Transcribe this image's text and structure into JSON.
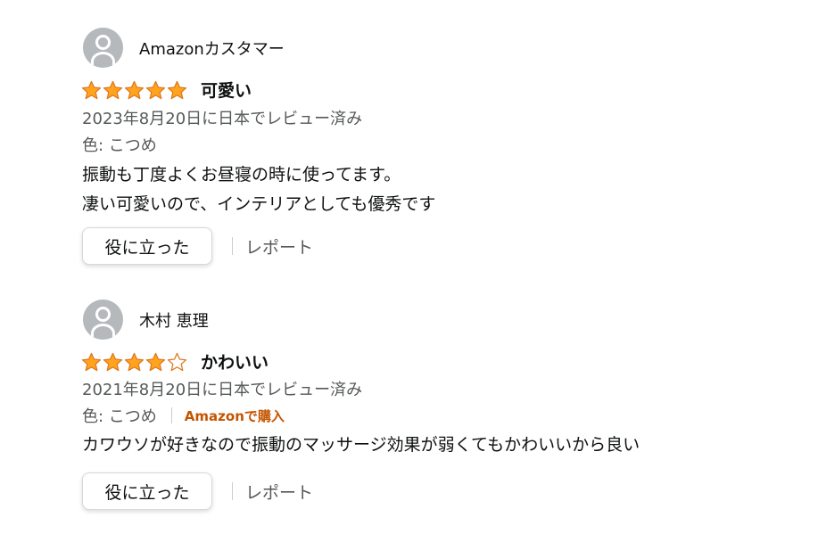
{
  "reviews": [
    {
      "profile_name": "Amazonカスタマー",
      "stars": 5,
      "title": "可愛い",
      "date": "2023年8月20日に日本でレビュー済み",
      "variant": "色: こつめ",
      "verified": "",
      "body": [
        "振動も丁度よくお昼寝の時に使ってます。",
        "凄い可愛いので、インテリアとしても優秀です"
      ],
      "helpful_label": "役に立った",
      "report_label": "レポート"
    },
    {
      "profile_name": "木村 恵理",
      "stars": 4,
      "title": "かわいい",
      "date": "2021年8月20日に日本でレビュー済み",
      "variant": "色: こつめ",
      "verified": "Amazonで購入",
      "body": [
        "カワウソが好きなので振動のマッサージ効果が弱くてもかわいいから良い"
      ],
      "helpful_label": "役に立った",
      "report_label": "レポート"
    }
  ],
  "colors": {
    "star": "#ffa41c",
    "star_outline": "#de7921",
    "verified": "#c45500"
  },
  "icons": {
    "avatar": "user-avatar-icon",
    "star_full": "star-filled-icon",
    "star_empty": "star-empty-icon"
  }
}
